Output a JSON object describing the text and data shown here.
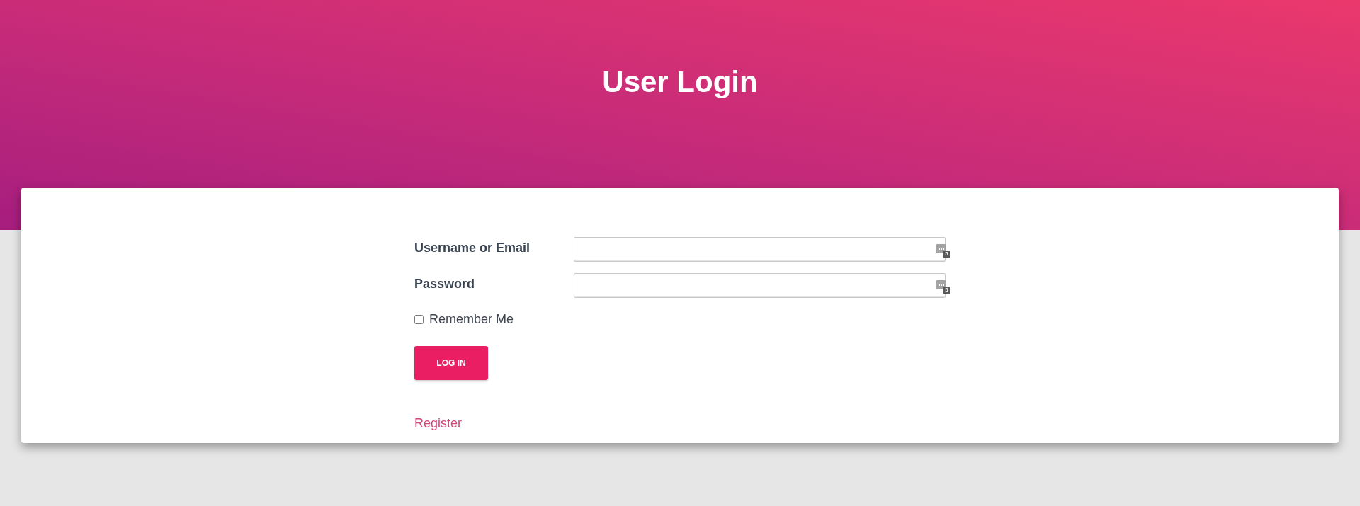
{
  "header": {
    "title": "User Login"
  },
  "form": {
    "fields": [
      {
        "label": "Username or Email",
        "badge": "5"
      },
      {
        "label": "Password",
        "badge": "5"
      }
    ],
    "remember": {
      "label": "Remember Me",
      "checked": false
    },
    "submit": "LOG IN",
    "register": "Register"
  }
}
